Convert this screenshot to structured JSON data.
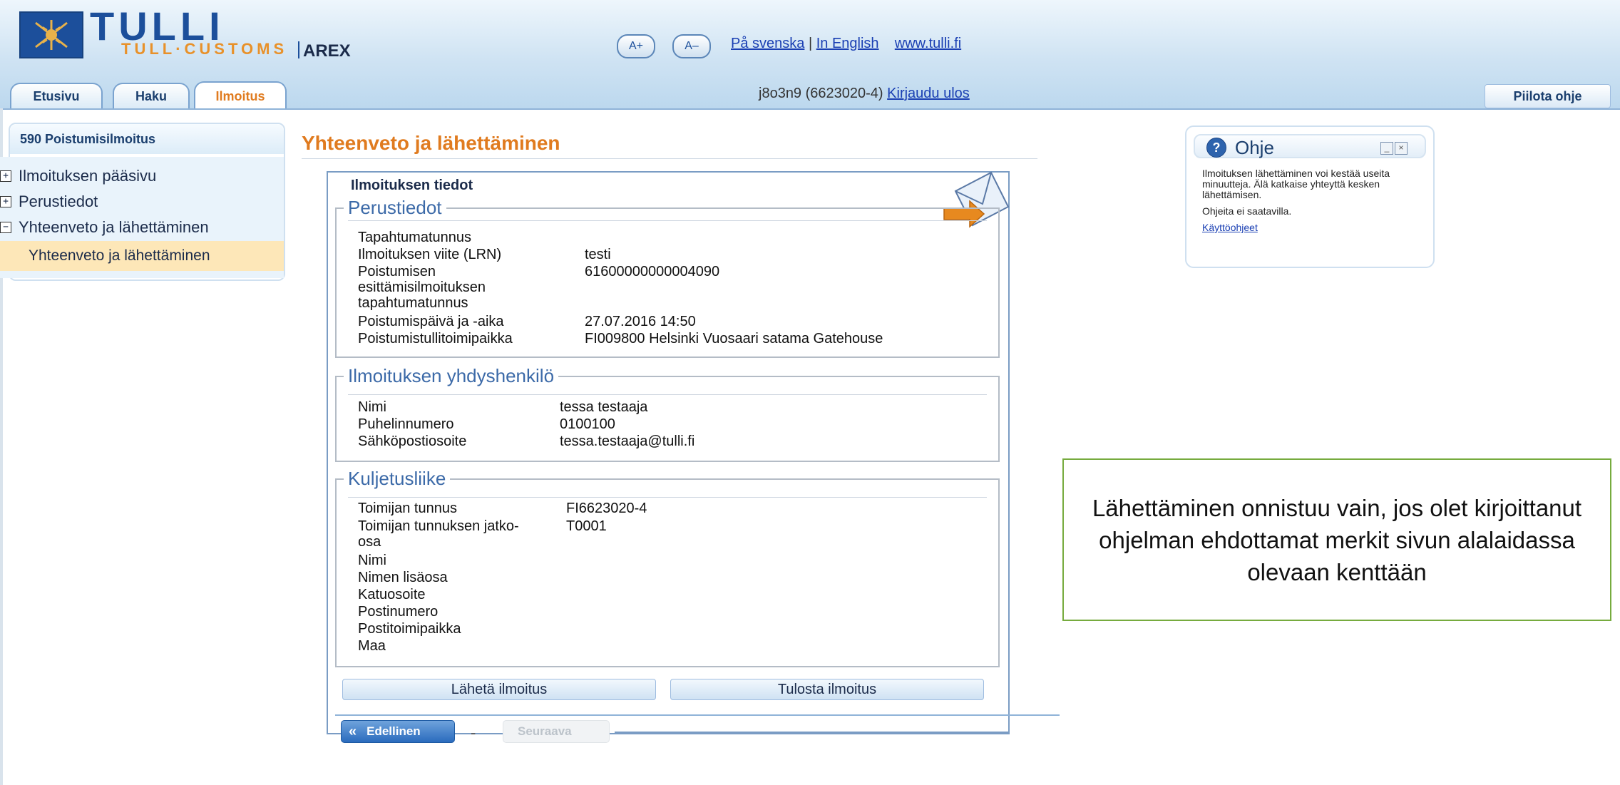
{
  "brand": {
    "name": "TULLI",
    "subtitle": "TULL·CUSTOMS",
    "app": "AREX"
  },
  "header": {
    "font_increase": "A+",
    "font_decrease": "A–",
    "lang_swedish": "På svenska",
    "lang_english": "In English",
    "site_link": "www.tulli.fi",
    "separator": "|"
  },
  "tabs": [
    {
      "label": "Etusivu"
    },
    {
      "label": "Haku"
    },
    {
      "label": "Ilmoitus",
      "active": true
    }
  ],
  "user": {
    "text": "j8o3n9 (6623020-4)",
    "logout": "Kirjaudu ulos"
  },
  "hide_help": "Piilota ohje",
  "sidebar": {
    "title": "590 Poistumisilmoitus",
    "items": [
      {
        "label": "Ilmoituksen pääsivu",
        "toggle": "+"
      },
      {
        "label": "Perustiedot",
        "toggle": "+"
      },
      {
        "label": "Yhteenveto ja lähettäminen",
        "toggle": "−"
      }
    ],
    "active_sub": "Yhteenveto ja lähettäminen"
  },
  "main": {
    "title": "Yhteenveto ja lähettäminen",
    "section_title": "Ilmoituksen tiedot",
    "perustiedot": {
      "legend": "Perustiedot",
      "rows": [
        {
          "label": "Tapahtumatunnus",
          "value": ""
        },
        {
          "label": "Ilmoituksen viite (LRN)",
          "value": "testi"
        },
        {
          "label": "Poistumisen\nesittämisilmoituksen\ntapahtumatunnus",
          "value": "61600000000004090"
        },
        {
          "label": "Poistumispäivä ja -aika",
          "value": "27.07.2016 14:50"
        },
        {
          "label": "Poistumistullitoimipaikka",
          "value": "FI009800  Helsinki Vuosaari satama Gatehouse"
        }
      ]
    },
    "yhdyshenkilo": {
      "legend": "Ilmoituksen yhdyshenkilö",
      "rows": [
        {
          "label": "Nimi",
          "value": "tessa testaaja"
        },
        {
          "label": "Puhelinnumero",
          "value": "0100100"
        },
        {
          "label": "Sähköpostiosoite",
          "value": "tessa.testaaja@tulli.fi"
        }
      ]
    },
    "kuljetusliike": {
      "legend": "Kuljetusliike",
      "rows": [
        {
          "label": "Toimijan tunnus",
          "value": "FI6623020-4"
        },
        {
          "label": "Toimijan tunnuksen jatko-\nosa",
          "value": "T0001"
        },
        {
          "label": "Nimi",
          "value": ""
        },
        {
          "label": "Nimen lisäosa",
          "value": ""
        },
        {
          "label": "Katuosoite",
          "value": ""
        },
        {
          "label": "Postinumero",
          "value": ""
        },
        {
          "label": "Postitoimipaikka",
          "value": ""
        },
        {
          "label": "Maa",
          "value": ""
        }
      ]
    },
    "send_button": "Lähetä ilmoitus",
    "print_button": "Tulosta ilmoitus",
    "prev_button": "Edellinen",
    "next_button": "Seuraava",
    "nav_separator": "-"
  },
  "help": {
    "title": "Ohje",
    "text1": "Ilmoituksen lähettäminen voi kestää useita minuutteja. Älä katkaise yhteyttä kesken lähettämisen.",
    "text2": "Ohjeita ei saatavilla.",
    "link": "Käyttöohjeet"
  },
  "callout": "Lähettäminen onnistuu vain, jos olet kirjoittanut ohjelman ehdottamat merkit sivun alalaidassa olevaan kenttään",
  "colors": {
    "accent_orange": "#e07b1f",
    "brand_blue": "#1c4f9b",
    "callout_border": "#76ab3e"
  }
}
